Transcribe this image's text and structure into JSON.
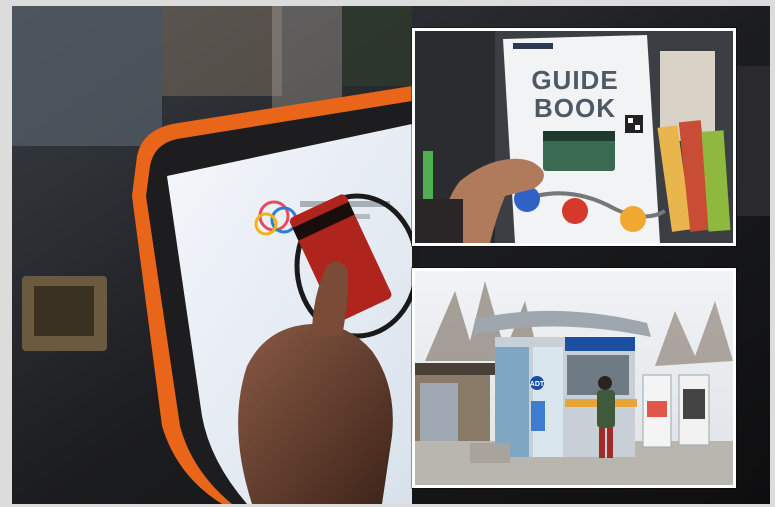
{
  "image": {
    "description_panels": [
      "tablet-card-tap",
      "guide-book",
      "ticket-booth"
    ]
  },
  "guide_book": {
    "title_line1": "GUIDE",
    "title_line2": "BOOK"
  },
  "booth": {
    "sign_text": "ADT"
  },
  "colors": {
    "tablet_bezel": "#e8651a",
    "booth_blue": "#1c4fa0",
    "card_red": "#b0241e"
  }
}
